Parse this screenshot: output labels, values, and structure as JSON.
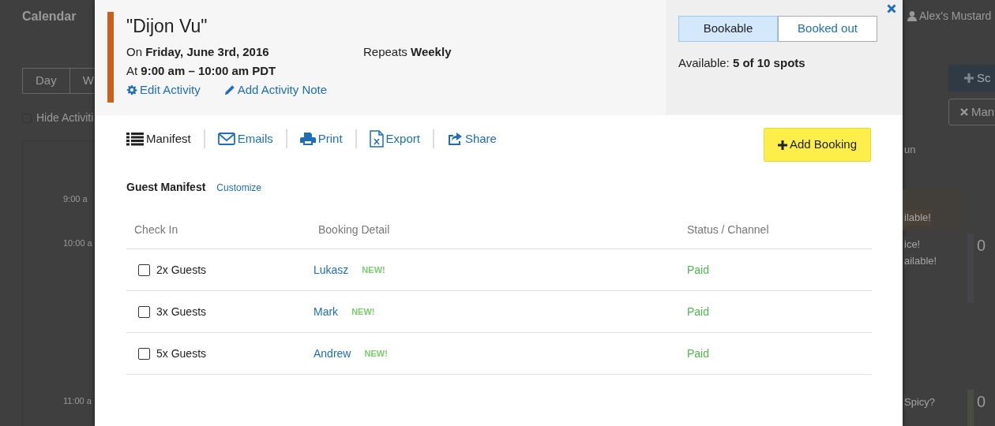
{
  "backdrop": {
    "left": {
      "title": "Calendar",
      "view_tabs": [
        {
          "label": "Day",
          "selected": false
        },
        {
          "label": "W",
          "selected": false
        }
      ],
      "hide_checkbox": {
        "label": "Hide Activiti",
        "checked": false
      },
      "times": [
        "9:00 a",
        "10:00 a",
        "11:00 a"
      ]
    },
    "right": {
      "user": "Alex's Mustard",
      "schedule_button": "Sc",
      "manage_button": "Man",
      "day_header": "un",
      "event_texts": [
        {
          "text": "ilable!",
          "color": "#4a4238"
        },
        {
          "text": "ice!",
          "color": "#3f3f3f"
        },
        {
          "text": "ailable!",
          "color": "#3f3f3f"
        },
        {
          "text": "Spicy?",
          "color": "#3f3f3f"
        }
      ],
      "counts": [
        {
          "text": "0",
          "color": "#47444d"
        },
        {
          "text": "0",
          "color": "#474d3f"
        }
      ]
    }
  },
  "activity": {
    "title": "\"Dijon Vu\"",
    "color": "#c8621a",
    "date": "On **Friday, June 3rd, 2016**",
    "time": "At **9:00 am – 10:00 am PDT**",
    "repeats": "Repeats **Weekly**",
    "links": [
      {
        "label": "Edit Activity"
      },
      {
        "label": "Add Activity Note"
      }
    ]
  },
  "status_toggle": [
    {
      "label": "Bookable",
      "selected": true
    },
    {
      "label": "Booked out",
      "selected": false
    }
  ],
  "availability": "Available: **5 of 10 spots**",
  "toolbar": [
    {
      "label": "Manifest",
      "selected": true
    },
    {
      "label": "Emails",
      "selected": false
    },
    {
      "label": "Print",
      "selected": false
    },
    {
      "label": "Export",
      "selected": false
    },
    {
      "label": "Share",
      "selected": false
    }
  ],
  "add_booking_button": "Add Booking",
  "manifest": {
    "title": "Guest Manifest",
    "customize_link": "Customize",
    "columns": [
      "Check In",
      "Booking Detail",
      "Status / Channel"
    ],
    "rows": [
      {
        "checked": false,
        "guests": "2x Guests",
        "name": "Lukasz",
        "badge": "NEW!",
        "status": "Paid"
      },
      {
        "checked": false,
        "guests": "3x Guests",
        "name": "Mark",
        "badge": "NEW!",
        "status": "Paid"
      },
      {
        "checked": false,
        "guests": "5x Guests",
        "name": "Andrew",
        "badge": "NEW!",
        "status": "Paid"
      }
    ]
  }
}
